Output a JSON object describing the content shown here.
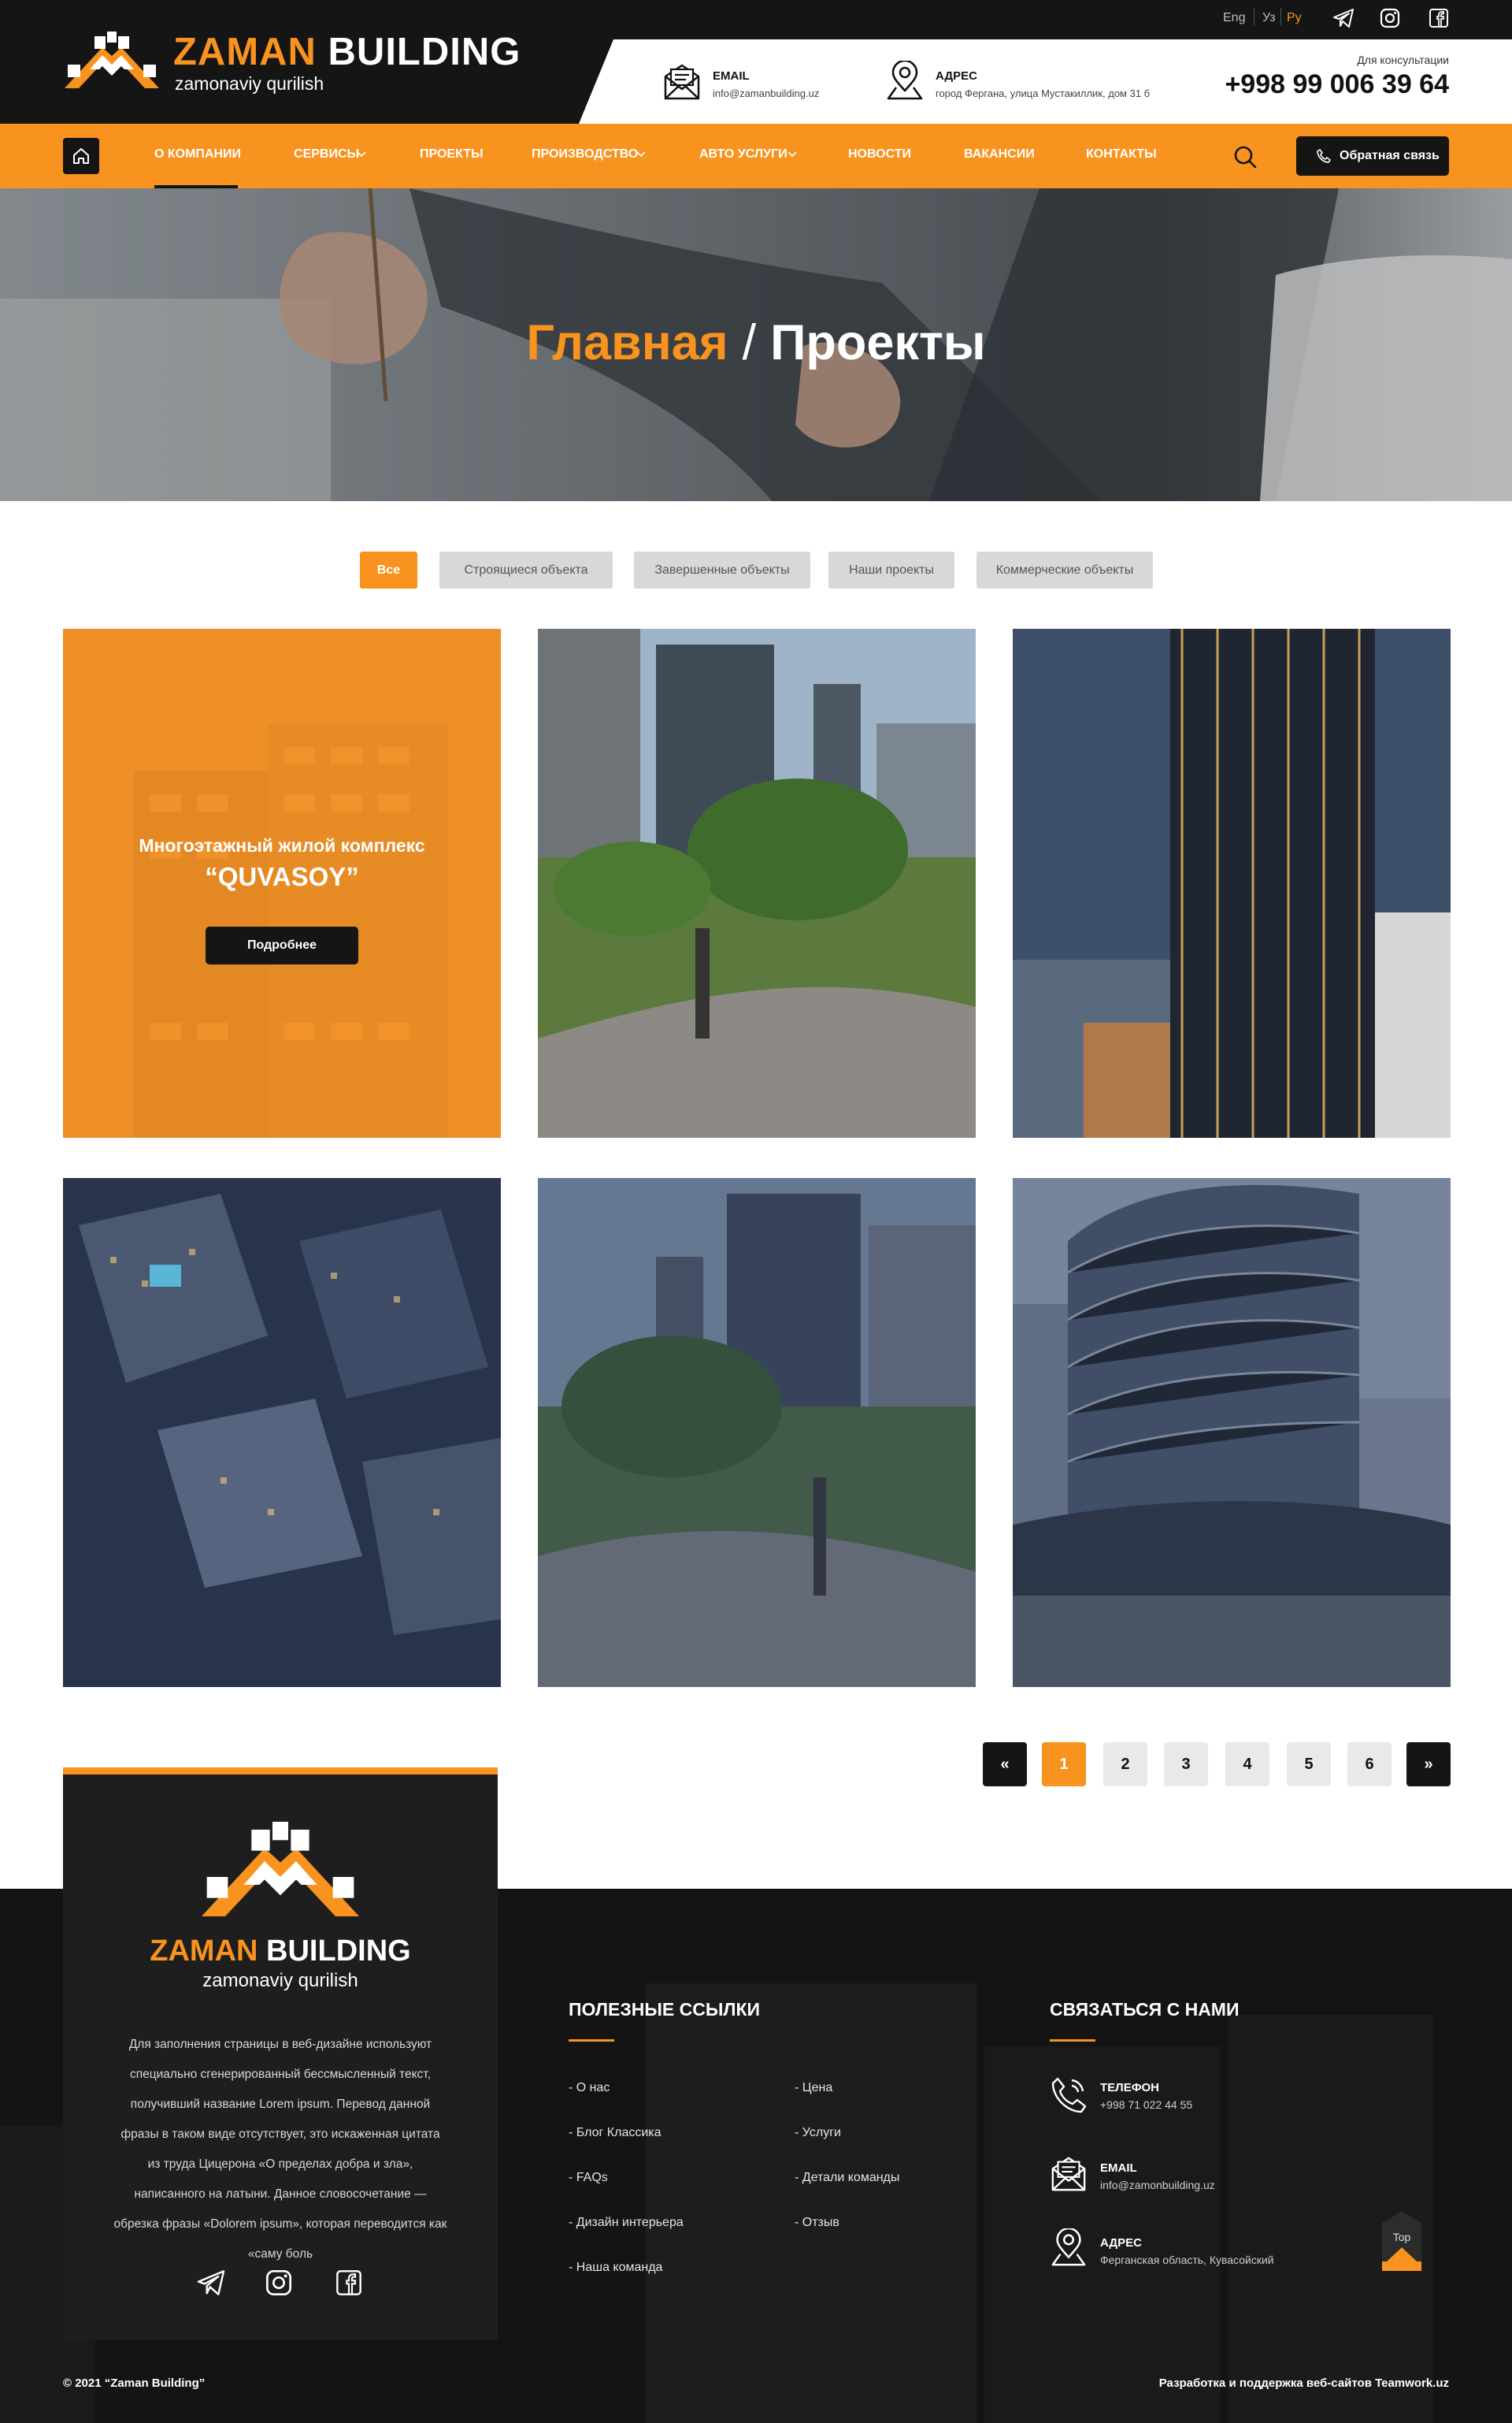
{
  "brand": {
    "name_part1": "ZAMAN",
    "name_part2": "BUILDING",
    "tagline": "zamonaviy qurilish"
  },
  "languages": [
    "Eng",
    "Уз",
    "Ру"
  ],
  "header": {
    "email_label": "EMAIL",
    "email_value": "info@zamanbuilding.uz",
    "address_label": "АДРЕС",
    "address_value": "город Фергана, улица Мустакиллик, дом 31 б",
    "consult_label": "Для консультации",
    "phone": "+998 99 006 39 64"
  },
  "nav": {
    "items": [
      "О КОМПАНИИ",
      "СЕРВИСЫ",
      "ПРОЕКТЫ",
      "ПРОИЗВОДСТВО",
      "АВТО УСЛУГИ",
      "НОВОСТИ",
      "ВАКАНСИИ",
      "КОНТАКТЫ"
    ],
    "callback": "Обратная связь"
  },
  "hero": {
    "crumb_home": "Главная",
    "separator": "/",
    "crumb_current": "Проекты"
  },
  "filters": [
    "Все",
    "Строящиеся объекта",
    "Завершенные объекты",
    "Наши проекты",
    "Коммерческие объекты"
  ],
  "featured": {
    "title": "Многоэтажный жилой комплекс",
    "subtitle": "“QUVASOY”",
    "button": "Подробнее"
  },
  "pagination": [
    "«",
    "1",
    "2",
    "3",
    "4",
    "5",
    "6",
    "»"
  ],
  "footer": {
    "about_text": "Для заполнения страницы в веб-дизайне используют специально сгенерированный бессмысленный текст, получивший название Lorem ipsum. Перевод данной фразы в таком виде отсутствует, это искаженная цитата из труда Цицерона «О пределах добра и зла», написанного на латыни. Данное словосочетание — обрезка фразы «Dolorem ipsum», которая переводится как «саму боль",
    "links_title": "ПОЛЕЗНЫЕ ССЫЛКИ",
    "links_col1": [
      "- О нас",
      "- Блог Классика",
      "- FAQs",
      "- Дизайн интерьера",
      "- Наша команда"
    ],
    "links_col2": [
      "- Цена",
      "- Услуги",
      "- Детали команды",
      "- Отзыв"
    ],
    "contact_title": "СВЯЗАТЬСЯ С НАМИ",
    "phone_label": "ТЕЛЕФОН",
    "phone_value": "+998 71 022 44 55",
    "email_label": "EMAIL",
    "email_value": "info@zamonbuilding.uz",
    "address_label": "АДРЕС",
    "address_value": "Ферганская область, Кувасойский",
    "top": "Top",
    "copyright": "© 2021 “Zaman Building”",
    "dev_credit": "Разработка и поддержка веб-сайтов Teamwork.uz"
  },
  "colors": {
    "accent": "#f7931e",
    "dark": "#151515",
    "filter_bg": "#d8d8d8"
  },
  "icons": [
    "home-icon",
    "search-icon",
    "phone-icon",
    "envelope-icon",
    "map-pin-icon",
    "telegram-icon",
    "instagram-icon",
    "facebook-icon",
    "chevron-down-icon"
  ]
}
